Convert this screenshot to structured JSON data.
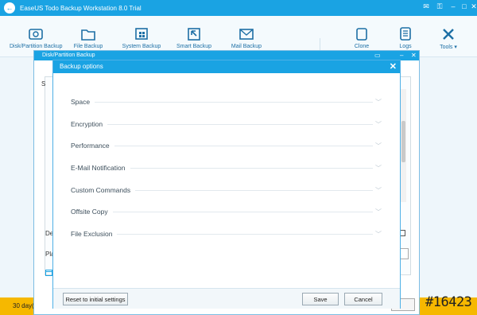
{
  "app": {
    "title": "EaseUS Todo Backup Workstation 8.0 Trial",
    "logo_glyph": "←",
    "window_controls": [
      "✉",
      "⚿",
      "–",
      "□",
      "✕"
    ]
  },
  "toolbar": {
    "disk_partition": "Disk/Partition Backup",
    "file_backup": "File Backup",
    "system_backup": "System Backup",
    "smart_backup": "Smart Backup",
    "mail_backup": "Mail Backup",
    "clone": "Clone",
    "logs": "Logs",
    "tools": "Tools ▾"
  },
  "underlay": {
    "title": "Disk/Partition Backup",
    "peek_de": "De",
    "peek_pla": "Pla",
    "peek_s": "S",
    "bottom_trial": "30 day("
  },
  "options_dialog": {
    "title": "Backup options",
    "close": "✕",
    "items": [
      {
        "label": "Space"
      },
      {
        "label": "Encryption"
      },
      {
        "label": "Performance"
      },
      {
        "label": "E-Mail Notification"
      },
      {
        "label": "Custom Commands"
      },
      {
        "label": "Offsite Copy"
      },
      {
        "label": "File Exclusion"
      }
    ],
    "reset_label": "Reset to initial settings",
    "save_label": "Save",
    "cancel_label": "Cancel"
  },
  "watermark": "#16423",
  "colors": {
    "accent": "#1aa3e3",
    "trial_bar": "#f6b800",
    "toolbar_text": "#1d6fa5"
  }
}
